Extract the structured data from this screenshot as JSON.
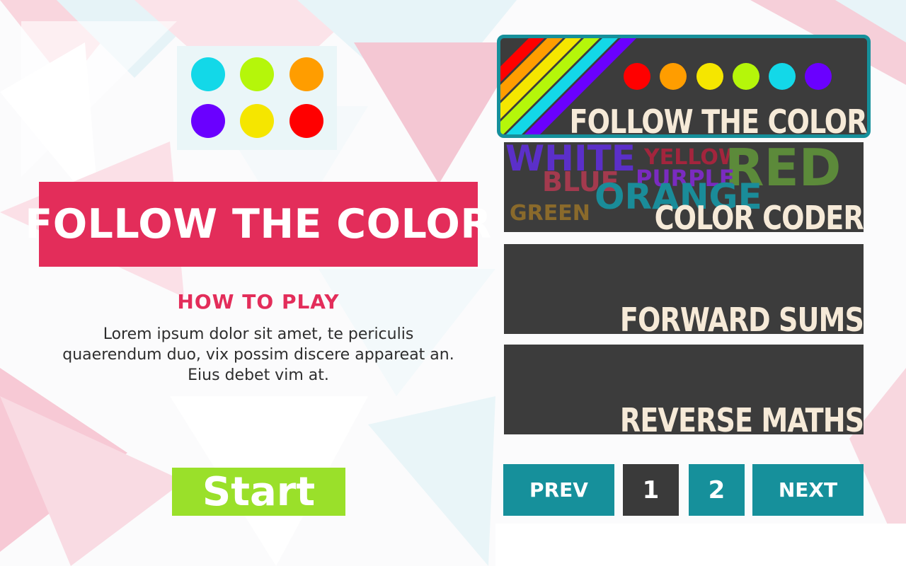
{
  "game": {
    "title": "FOLLOW THE COLOR",
    "how_to_play_heading": "HOW TO PLAY",
    "how_to_play_text": "Lorem ipsum dolor sit amet, te periculis quaerendum duo, vix possim discere appareat an. Eius debet vim at.",
    "start_label": "Start",
    "palette_colors": [
      "#13d8e8",
      "#b5f60a",
      "#ff9d00",
      "#6a00ff",
      "#f5e600",
      "#ff0000"
    ]
  },
  "game_list": {
    "selected_index": 0,
    "cards": [
      {
        "title": "FOLLOW THE COLOR",
        "selected": true,
        "dot_colors": [
          "#ff0000",
          "#ff9d00",
          "#f5e600",
          "#b5f60a",
          "#13d8e8",
          "#6a00ff"
        ],
        "stripe_colors": [
          "#ff0000",
          "#ff9d00",
          "#f5e600",
          "#b5f60a",
          "#13d8e8",
          "#6a00ff"
        ]
      },
      {
        "title": "COLOR CODER",
        "selected": false,
        "words": [
          {
            "text": "WHITE",
            "color": "#5b2fc9"
          },
          {
            "text": "YELLOW",
            "color": "#a3253d"
          },
          {
            "text": "RED",
            "color": "#5c8a3a"
          },
          {
            "text": "BLUE",
            "color": "#a33a4e"
          },
          {
            "text": "PURPLE",
            "color": "#7a2bc0"
          },
          {
            "text": "ORANGE",
            "color": "#1a8c99"
          },
          {
            "text": "GREEN",
            "color": "#8a6a2b"
          }
        ]
      },
      {
        "title": "FORWARD SUMS",
        "selected": false
      },
      {
        "title": "REVERSE MATHS",
        "selected": false
      }
    ]
  },
  "pagination": {
    "prev_label": "PREV",
    "next_label": "NEXT",
    "pages": [
      "1",
      "2"
    ],
    "current_page": "1",
    "active_color": "#3a3a3a",
    "button_color": "#16909b"
  }
}
